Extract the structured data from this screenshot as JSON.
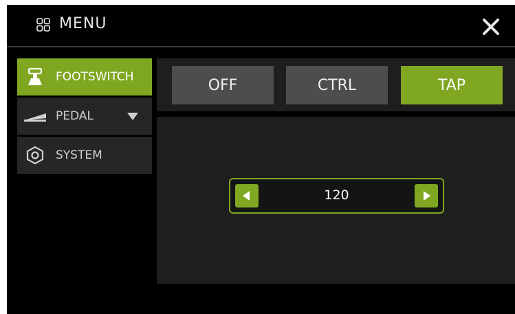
{
  "header": {
    "menu_icon": "grid-icon",
    "title": "MENU",
    "close_icon": "close-icon"
  },
  "sidebar": {
    "items": [
      {
        "label": "FOOTSWITCH",
        "icon": "footswitch-icon",
        "active": true
      },
      {
        "label": "PEDAL",
        "icon": "pedal-icon",
        "active": false,
        "has_dropdown": true
      },
      {
        "label": "SYSTEM",
        "icon": "hexagon-icon",
        "active": false
      }
    ]
  },
  "tabs": [
    {
      "label": "OFF",
      "active": false
    },
    {
      "label": "CTRL",
      "active": false
    },
    {
      "label": "TAP",
      "active": true
    }
  ],
  "stepper": {
    "value": "120",
    "decrement_icon": "triangle-left-icon",
    "increment_icon": "triangle-right-icon"
  },
  "colors": {
    "accent": "#7fa722",
    "background": "#000000",
    "panel": "#1e1e1e",
    "tab_inactive": "#4d4d4d",
    "sidebar_inactive": "#262626"
  }
}
